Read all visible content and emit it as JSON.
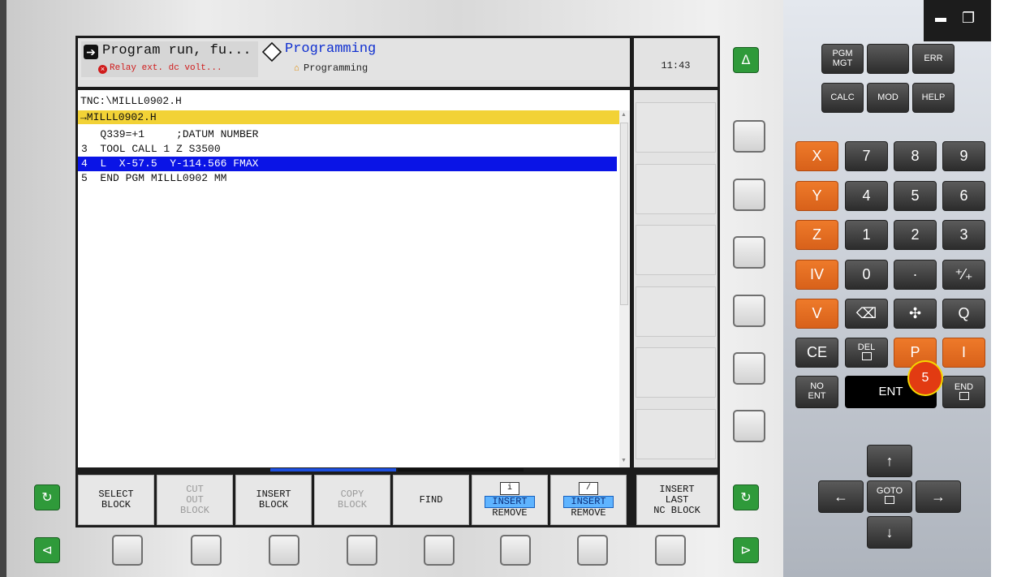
{
  "window": {
    "minimize": "–",
    "restore": "❐"
  },
  "header": {
    "mode1": {
      "title": "Program run, fu...",
      "error": "Relay ext. dc volt..."
    },
    "mode2": {
      "title": "Programming",
      "sub": "Programming"
    },
    "clock": "11:43"
  },
  "program": {
    "path": "TNC:\\MILLL0902.H",
    "filename": "→MILLL0902.H",
    "lines": [
      "   Q339=+1     ;DATUM NUMBER",
      "3  TOOL CALL 1 Z S3500",
      "4  L  X-57.5  Y-114.566 FMAX",
      "5  END PGM MILLL0902 MM"
    ],
    "selected_line": 2
  },
  "softkeys": [
    {
      "label": "SELECT\nBLOCK",
      "enabled": true
    },
    {
      "label": "CUT\nOUT\nBLOCK",
      "enabled": false
    },
    {
      "label": "INSERT\nBLOCK",
      "enabled": true
    },
    {
      "label": "COPY\nBLOCK",
      "enabled": false
    },
    {
      "label": "FIND",
      "enabled": true
    },
    {
      "icon": "i",
      "top": "INSERT",
      "bottom": "REMOVE",
      "enabled": true
    },
    {
      "icon": "/",
      "top": "INSERT",
      "bottom": "REMOVE",
      "enabled": true
    },
    {
      "label": "INSERT\nLAST\nNC BLOCK",
      "enabled": true
    }
  ],
  "green_buttons": {
    "up": "Δ",
    "left": "⊲",
    "right": "⊳",
    "switch": "↻"
  },
  "keypad": {
    "top": [
      "PGM\nMGT",
      "",
      "ERR",
      "CALC",
      "MOD",
      "HELP"
    ],
    "rows": [
      [
        "X",
        "7",
        "8",
        "9"
      ],
      [
        "Y",
        "4",
        "5",
        "6"
      ],
      [
        "Z",
        "1",
        "2",
        "3"
      ],
      [
        "IV",
        "0",
        "·",
        "⁺⁄₊"
      ],
      [
        "V",
        "⌫",
        "✣",
        "Q"
      ],
      [
        "CE",
        "DEL",
        "P",
        "I"
      ]
    ],
    "no_ent": "NO\nENT",
    "ent": "ENT",
    "end": "END",
    "goto": "GOTO",
    "arrows": {
      "up": "↑",
      "down": "↓",
      "left": "←",
      "right": "→"
    }
  },
  "badge": "5"
}
